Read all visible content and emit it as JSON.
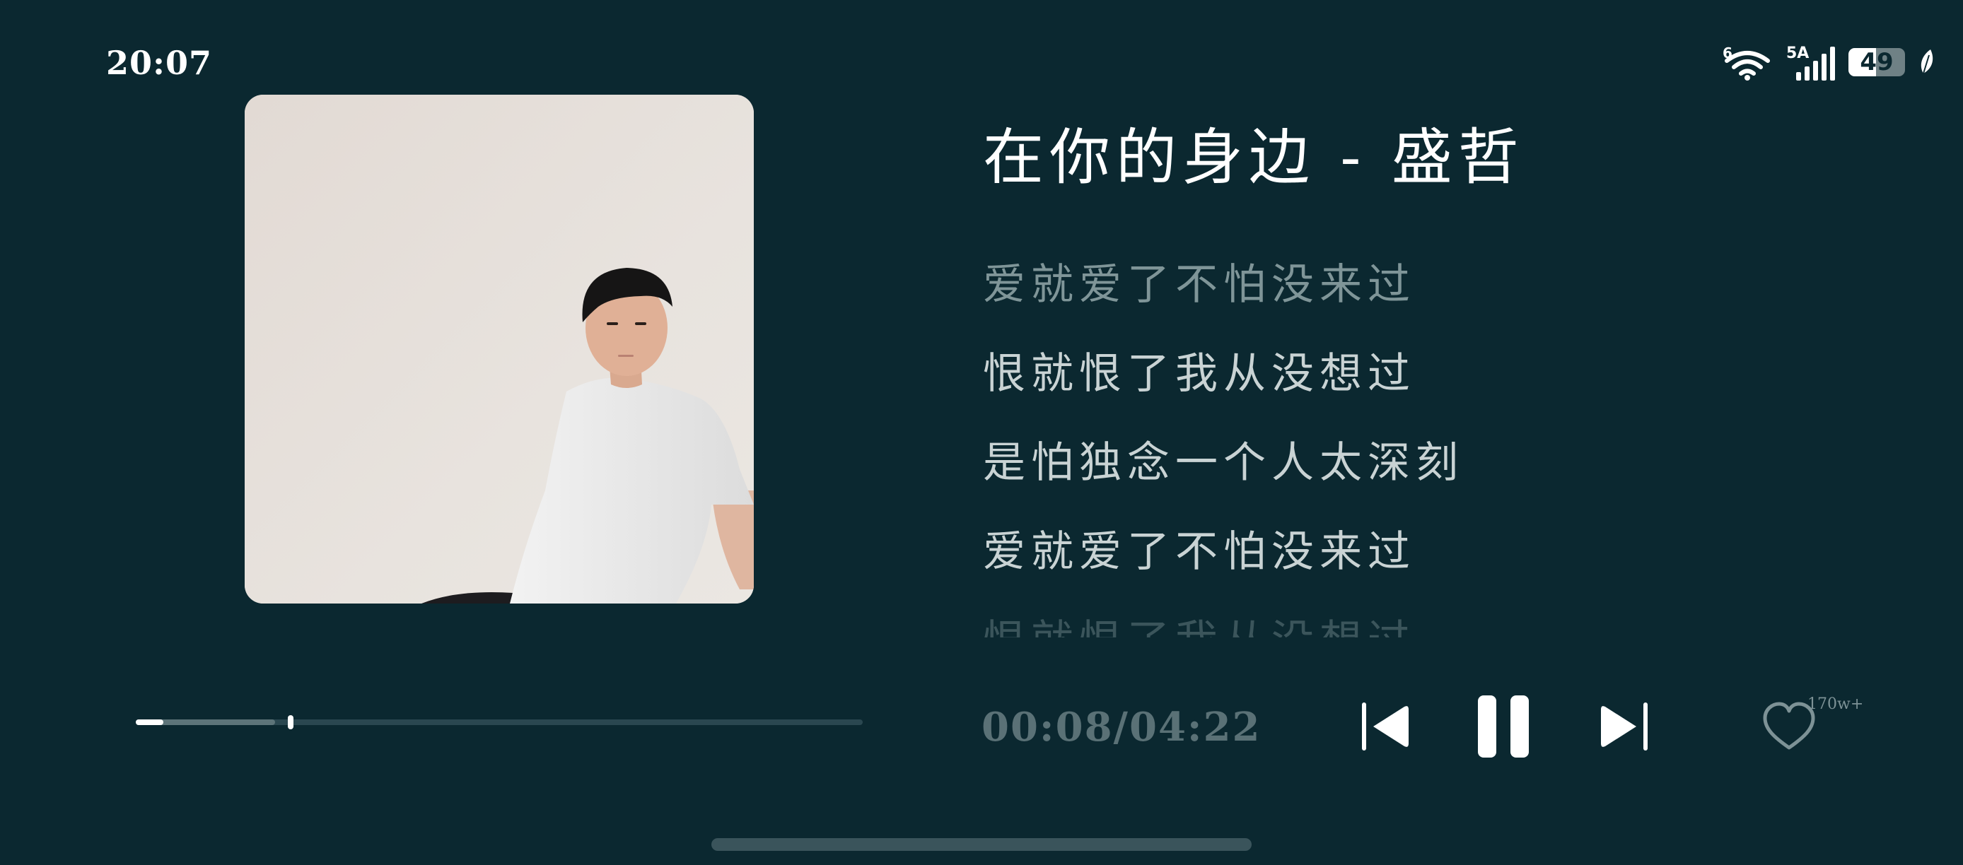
{
  "status_bar": {
    "time": "20:07",
    "wifi_label": "6",
    "network_label": "5A",
    "battery_level": "49",
    "battery_fraction": 0.49,
    "icons": [
      "wifi-icon",
      "signal-icon",
      "battery-icon",
      "leaf-icon"
    ]
  },
  "player": {
    "album_art": "album-cover-photo",
    "title": "在你的身边 - 盛哲",
    "lyrics": [
      "爱就爱了不怕没来过",
      "恨就恨了我从没想过",
      "是怕独念一个人太深刻",
      "爱就爱了不怕没来过",
      "恨就恨了我从没想过"
    ],
    "time_display": "00:08/04:22",
    "progress_fraction": 0.213,
    "buffered_fraction": 0.192,
    "like_count": "170w+",
    "controls": [
      "previous-track-icon",
      "pause-icon",
      "next-track-icon",
      "heart-icon"
    ]
  },
  "colors": {
    "background": "#0b2830",
    "lyric_dim": "#7f9598",
    "lyric_mid": "#c9d3d4",
    "time_readout": "#5a7176"
  }
}
